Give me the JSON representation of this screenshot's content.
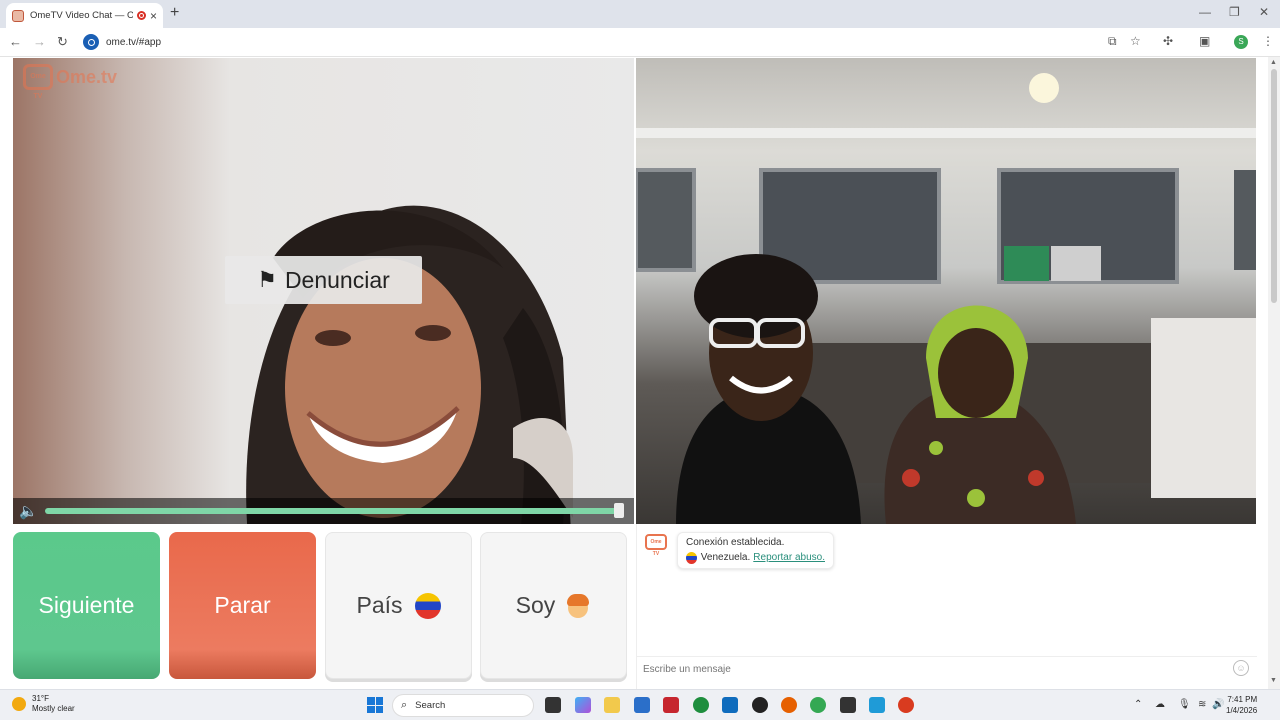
{
  "browser": {
    "tab_title": "OmeTV Video Chat — Ome",
    "tab_close": "×",
    "new_tab": "+",
    "url": "ome.tv/#app",
    "profile_initial": "S",
    "window_controls": [
      "—",
      "❐",
      "✕"
    ]
  },
  "brand": {
    "logo_mark": "Ome TV",
    "logo_text": "Ome.tv",
    "accent": "#e8744f"
  },
  "video": {
    "report_label": "Denunciar",
    "volume_fraction": 1.0
  },
  "controls": {
    "next_label": "Siguiente",
    "stop_label": "Parar",
    "country_label": "País",
    "gender_label": "Soy",
    "next_color": "#5ec78e",
    "stop_color": "#ec7b60"
  },
  "chat": {
    "status": "Conexión establecida.",
    "country": "Venezuela.",
    "report_link": "Reportar abuso.",
    "input_placeholder": "Escribe un mensaje"
  },
  "taskbar": {
    "weather_temp": "31°F",
    "weather_desc": "Mostly clear",
    "search_label": "Search",
    "time": "7:41 PM",
    "date": "1/4/2026"
  }
}
